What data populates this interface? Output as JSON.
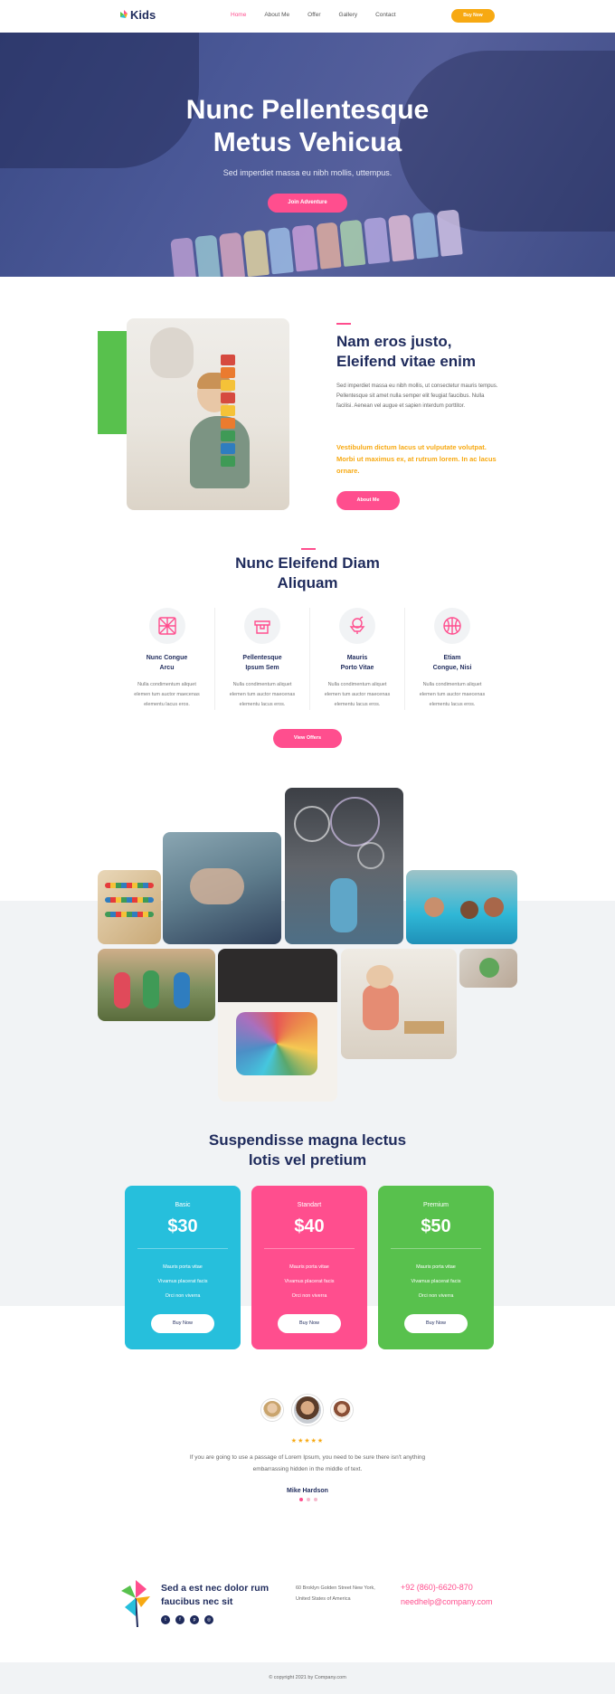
{
  "nav": {
    "logo": "Kids",
    "links": [
      "Home",
      "About Me",
      "Offer",
      "Gallery",
      "Contact"
    ],
    "cta": "Buy Now"
  },
  "hero": {
    "title_line1": "Nunc Pellentesque",
    "title_line2": "Metus Vehicua",
    "subtitle": "Sed imperdiet massa eu nibh mollis, uttempus.",
    "button": "Join Adventure"
  },
  "about": {
    "title_line1": "Nam eros justo,",
    "title_line2": "Eleifend vitae enim",
    "text": "Sed imperdiet massa eu nibh mollis, ut consectetur mauris tempus. Pellentesque sit amet nulla semper elit feugiat faucibus. Nulla facilisi. Aenean vel augue et sapien interdum porttitor.",
    "highlight": "Vestibulum dictum lacus ut vulputate volutpat. Morbi ut maximus ex, at rutrum lorem. In ac lacus ornare.",
    "button": "About Me"
  },
  "features": {
    "title_line1": "Nunc Eleifend Diam",
    "title_line2": "Aliquam",
    "items": [
      {
        "name_line1": "Nunc Congue",
        "name_line2": "Arcu",
        "desc": "Nulla condimentum aliquet elemen tum auctor maecenas elementu lacus eros.",
        "icon": "ball-pit-icon"
      },
      {
        "name_line1": "Pellentesque",
        "name_line2": "Ipsum Sem",
        "desc": "Nulla condimentum aliquet elemen tum auctor maecenas elementu lacus eros.",
        "icon": "sandbox-icon"
      },
      {
        "name_line1": "Mauris",
        "name_line2": "Porto Vitae",
        "desc": "Nulla condimentum aliquet elemen tum auctor maecenas elementu lacus eros.",
        "icon": "ice-cream-icon"
      },
      {
        "name_line1": "Etiam",
        "name_line2": "Congue, Nisi",
        "desc": "Nulla condimentum aliquet elemen tum auctor maecenas elementu lacus eros.",
        "icon": "basketball-icon"
      }
    ],
    "button": "View Offers"
  },
  "pricing": {
    "title_line1": "Suspendisse magna lectus",
    "title_line2": "lotis vel pretium",
    "plans": [
      {
        "name": "Basic",
        "price": "$30",
        "color": "#26bfdc",
        "features": [
          "Mauris porta vitae",
          "Vivamus placerat facis",
          "Orci non viverra"
        ],
        "button": "Buy Now"
      },
      {
        "name": "Standart",
        "price": "$40",
        "color": "#ff4e8e",
        "features": [
          "Mauris porta vitae",
          "Vivamus placerat facis",
          "Orci non viverra"
        ],
        "button": "Buy Now"
      },
      {
        "name": "Premium",
        "price": "$50",
        "color": "#58c14d",
        "features": [
          "Mauris porta vitae",
          "Vivamus placerat facis",
          "Orci non viverra"
        ],
        "button": "Buy Now"
      }
    ]
  },
  "testimonial": {
    "stars": "★★★★★",
    "quote": "If you are going to use a passage of Lorem Ipsum, you need to be sure there isn't anything embarrassing hidden in the middle of text.",
    "author": "Mike Hardson"
  },
  "footer": {
    "title": "Sed a est nec dolor rum faucibus nec sit",
    "address_line1": "60 Broklyn Golden Street New York,",
    "address_line2": "United States of America",
    "phone": "+92 (860)-6620-870",
    "email": "needhelp@company.com",
    "socials": [
      "twitter-icon",
      "facebook-icon",
      "pinterest-icon",
      "instagram-icon"
    ],
    "copyright": "© copyright 2021 by Company.com"
  },
  "colors": {
    "navy": "#1f2b5c",
    "pink": "#ff4e8e",
    "yellow": "#f7a912",
    "blue": "#26bfdc",
    "green": "#58c14d",
    "light_bg": "#f1f3f5"
  }
}
